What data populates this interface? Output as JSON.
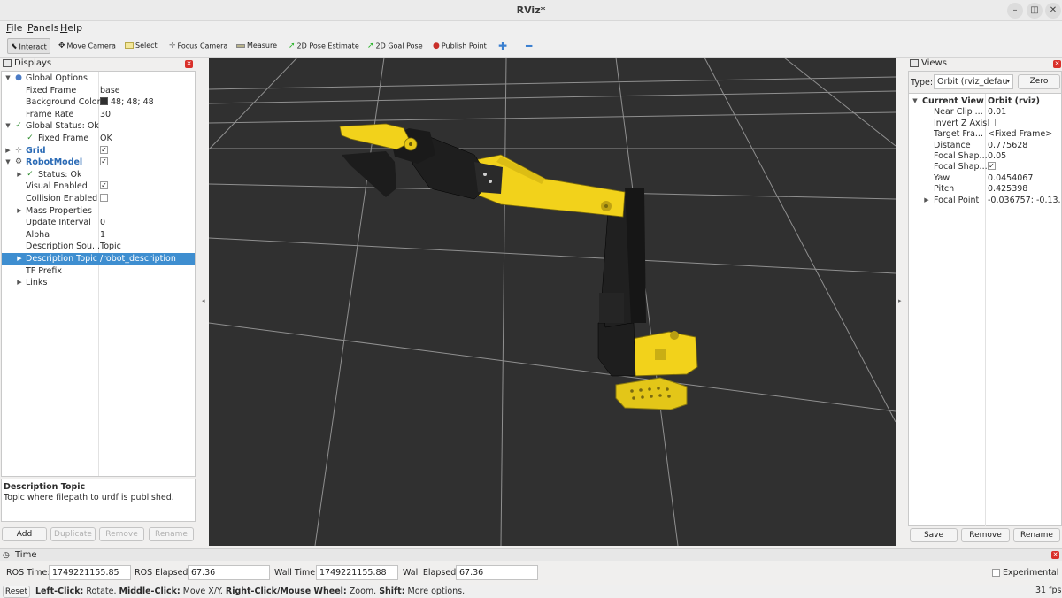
{
  "window": {
    "title": "RViz*"
  },
  "menu": [
    "File",
    "Panels",
    "Help"
  ],
  "toolbar": [
    {
      "label": "Interact",
      "icon": "cursor-icon"
    },
    {
      "label": "Move Camera",
      "icon": "move-camera-icon"
    },
    {
      "label": "Select",
      "icon": "select-icon"
    },
    {
      "label": "Focus Camera",
      "icon": "focus-camera-icon"
    },
    {
      "label": "Measure",
      "icon": "ruler-icon"
    },
    {
      "label": "2D Pose Estimate",
      "icon": "green-arrow-icon"
    },
    {
      "label": "2D Goal Pose",
      "icon": "green-arrow-icon"
    },
    {
      "label": "Publish Point",
      "icon": "map-pin-icon"
    }
  ],
  "displays": {
    "title": "Displays",
    "rows": [
      {
        "name": "Global Options",
        "value": ""
      },
      {
        "name": "Fixed Frame",
        "value": "base"
      },
      {
        "name": "Background Color",
        "value": "48; 48; 48"
      },
      {
        "name": "Frame Rate",
        "value": "30"
      },
      {
        "name": "Global Status: Ok",
        "value": ""
      },
      {
        "name": "Fixed Frame",
        "value": "OK"
      },
      {
        "name": "Grid",
        "value": ""
      },
      {
        "name": "RobotModel",
        "value": ""
      },
      {
        "name": "Status: Ok",
        "value": ""
      },
      {
        "name": "Visual Enabled",
        "value": ""
      },
      {
        "name": "Collision Enabled",
        "value": ""
      },
      {
        "name": "Mass Properties",
        "value": ""
      },
      {
        "name": "Update Interval",
        "value": "0"
      },
      {
        "name": "Alpha",
        "value": "1"
      },
      {
        "name": "Description Sou...",
        "value": "Topic"
      },
      {
        "name": "Description Topic",
        "value": "/robot_description"
      },
      {
        "name": "TF Prefix",
        "value": ""
      },
      {
        "name": "Links",
        "value": ""
      }
    ],
    "description_title": "Description Topic",
    "description_text": "Topic where filepath to urdf is published.",
    "buttons": [
      "Add",
      "Duplicate",
      "Remove",
      "Rename"
    ]
  },
  "views": {
    "title": "Views",
    "type_label": "Type:",
    "type_value": "Orbit (rviz_defau",
    "zero_label": "Zero",
    "rows": [
      {
        "name": "Current View",
        "value": "Orbit (rviz)"
      },
      {
        "name": "Near Clip ...",
        "value": "0.01"
      },
      {
        "name": "Invert Z Axis",
        "value": ""
      },
      {
        "name": "Target Fra...",
        "value": "<Fixed Frame>"
      },
      {
        "name": "Distance",
        "value": "0.775628"
      },
      {
        "name": "Focal Shap...",
        "value": "0.05"
      },
      {
        "name": "Focal Shap...",
        "value": ""
      },
      {
        "name": "Yaw",
        "value": "0.0454067"
      },
      {
        "name": "Pitch",
        "value": "0.425398"
      },
      {
        "name": "Focal Point",
        "value": "-0.036757; -0.13..."
      }
    ],
    "buttons": [
      "Save",
      "Remove",
      "Rename"
    ]
  },
  "time": {
    "title": "Time",
    "ros_time_label": "ROS Time:",
    "ros_time": "1749221155.85",
    "ros_elapsed_label": "ROS Elapsed:",
    "ros_elapsed": "67.36",
    "wall_time_label": "Wall Time:",
    "wall_time": "1749221155.88",
    "wall_elapsed_label": "Wall Elapsed:",
    "wall_elapsed": "67.36",
    "experimental_label": "Experimental"
  },
  "status": {
    "reset_label": "Reset",
    "left_click": "Left-Click:",
    "left_click_desc": " Rotate. ",
    "middle_click": "Middle-Click:",
    "middle_click_desc": " Move X/Y. ",
    "right_click": "Right-Click/Mouse Wheel:",
    "right_click_desc": " Zoom. ",
    "shift": "Shift:",
    "shift_desc": " More options.",
    "fps": "31 fps"
  },
  "colors": {
    "viewport_bg": "#303030",
    "robot_yellow": "#f2d21b",
    "robot_black": "#1e1e1e",
    "selection": "#3e8ed0",
    "link_blue": "#2a6ab5"
  }
}
